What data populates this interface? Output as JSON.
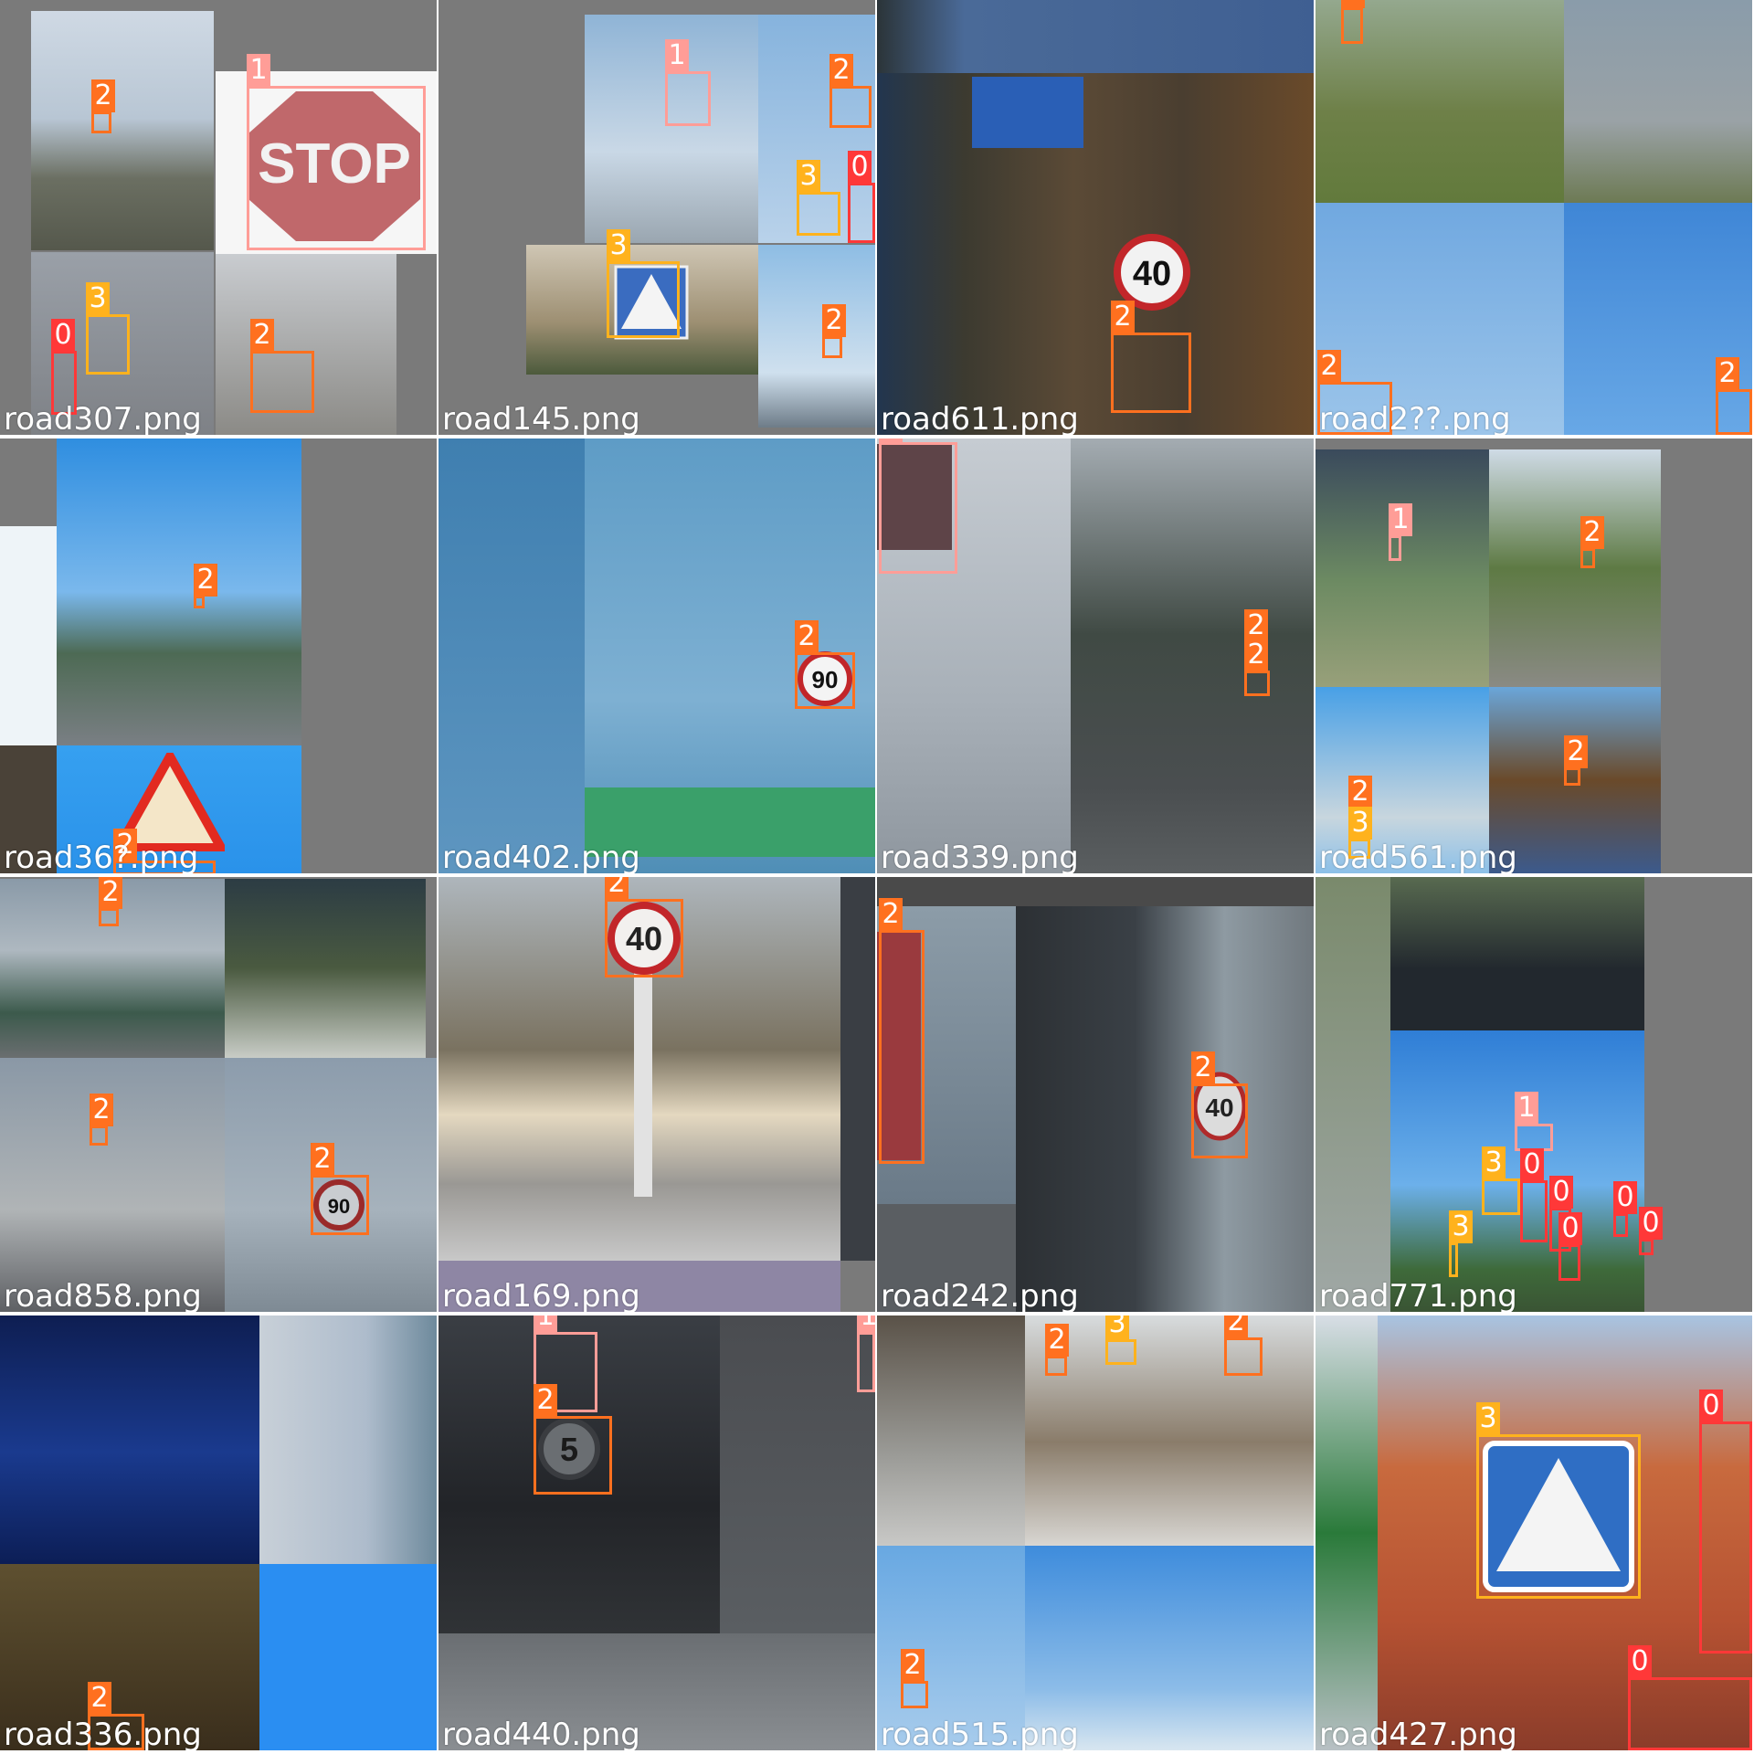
{
  "class_colors": {
    "0": "#ff3838",
    "1": "#ff9d97",
    "2": "#ff701f",
    "3": "#ffb21d"
  },
  "tiles": [
    {
      "filename": "road307.png",
      "labels": [
        "2",
        "1",
        "3",
        "0",
        "2"
      ]
    },
    {
      "filename": "road145.png",
      "labels": [
        "1",
        "2",
        "3",
        "0",
        "3",
        "2"
      ]
    },
    {
      "filename": "road611.png",
      "labels": [
        "2"
      ]
    },
    {
      "filename": "road2??.png",
      "labels": [
        "2",
        "2",
        "2"
      ]
    },
    {
      "filename": "road36?.png",
      "labels": [
        "2",
        "2"
      ]
    },
    {
      "filename": "road402.png",
      "labels": [
        "2"
      ]
    },
    {
      "filename": "road339.png",
      "labels": [
        "1",
        "2",
        "2"
      ]
    },
    {
      "filename": "road561.png",
      "labels": [
        "1",
        "2",
        "2",
        "2",
        "3"
      ]
    },
    {
      "filename": "road858.png",
      "labels": [
        "2",
        "2",
        "2"
      ]
    },
    {
      "filename": "road169.png",
      "labels": [
        "2"
      ]
    },
    {
      "filename": "road242.png",
      "labels": [
        "2",
        "2"
      ]
    },
    {
      "filename": "road771.png",
      "labels": [
        "1",
        "3",
        "0",
        "0",
        "0",
        "0",
        "0",
        "3"
      ]
    },
    {
      "filename": "road336.png",
      "labels": [
        "2"
      ]
    },
    {
      "filename": "road440.png",
      "labels": [
        "1",
        "2",
        "1"
      ]
    },
    {
      "filename": "road515.png",
      "labels": [
        "2",
        "3",
        "2",
        "2"
      ]
    },
    {
      "filename": "road427.png",
      "labels": [
        "3",
        "0",
        "0"
      ]
    }
  ]
}
